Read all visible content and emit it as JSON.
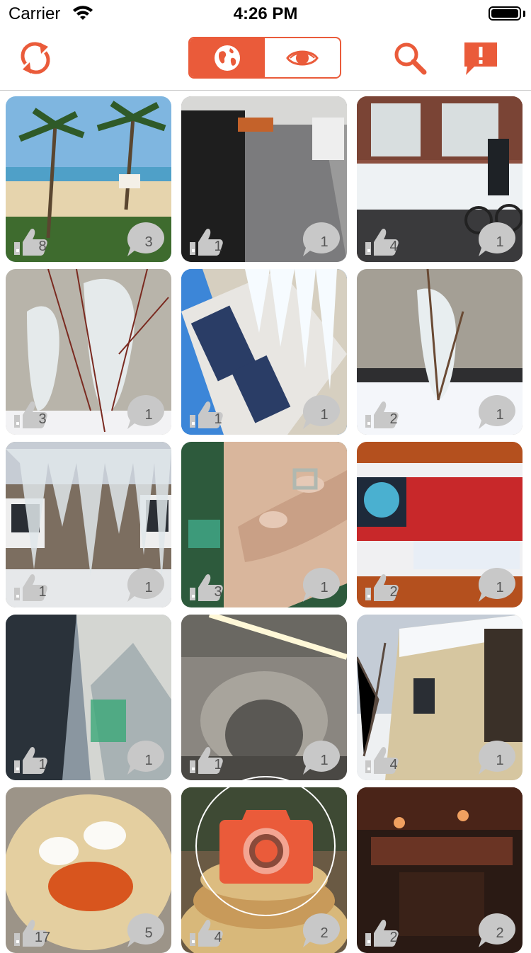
{
  "status_bar": {
    "carrier": "Carrier",
    "time": "4:26 PM",
    "wifi_icon": "wifi-icon",
    "battery_icon": "battery-icon"
  },
  "nav": {
    "refresh_icon": "refresh-icon",
    "segments": [
      {
        "icon": "globe-icon",
        "selected": true
      },
      {
        "icon": "eye-icon",
        "selected": false
      }
    ],
    "search_icon": "search-icon",
    "report_icon": "report-icon"
  },
  "colors": {
    "accent": "#ea5b3a",
    "overlay_icon": "#c8c8c8",
    "overlay_text": "#555555"
  },
  "photos": [
    {
      "likes": "8",
      "comments": "3"
    },
    {
      "likes": "1",
      "comments": "1"
    },
    {
      "likes": "4",
      "comments": "1"
    },
    {
      "likes": "3",
      "comments": "1"
    },
    {
      "likes": "1",
      "comments": "1"
    },
    {
      "likes": "2",
      "comments": "1"
    },
    {
      "likes": "1",
      "comments": "1"
    },
    {
      "likes": "3",
      "comments": "1"
    },
    {
      "likes": "2",
      "comments": "1"
    },
    {
      "likes": "1",
      "comments": "1"
    },
    {
      "likes": "1",
      "comments": "1"
    },
    {
      "likes": "4",
      "comments": "1"
    },
    {
      "likes": "17",
      "comments": "5"
    },
    {
      "likes": "4",
      "comments": "2"
    },
    {
      "likes": "2",
      "comments": "2"
    }
  ],
  "camera_button": {
    "icon": "camera-icon"
  }
}
